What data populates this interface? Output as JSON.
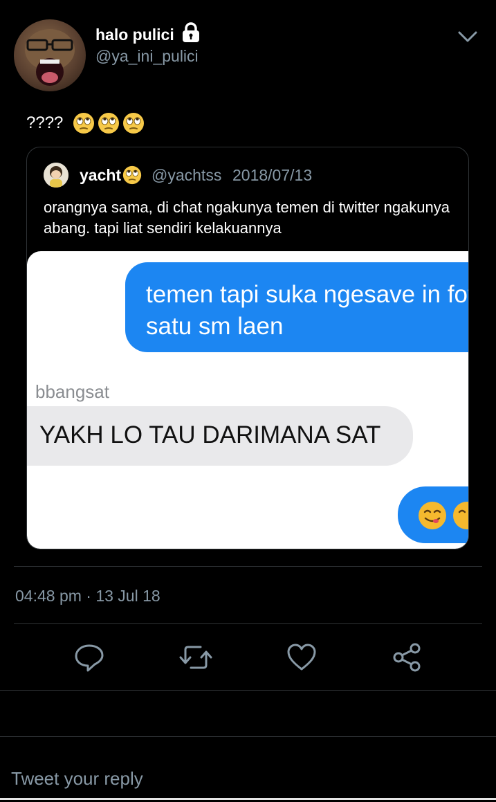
{
  "author": {
    "display_name": "halo pulici",
    "handle": "@ya_ini_pulici",
    "protected": true
  },
  "tweet": {
    "text": "????",
    "emoji_count": 3,
    "timestamp": "04:48 pm · 13 Jul 18"
  },
  "quoted_tweet": {
    "display_name": "yacht",
    "handle": "@yachtss",
    "date": "2018/07/13",
    "text": "orangnya sama, di chat ngakunya temen di twitter ngakunya abang. tapi liat sendiri kelakuannya",
    "image": {
      "outgoing_message": "temen tapi suka ngesave in foto\nsatu sm laen",
      "sender_name": "bbangsat",
      "incoming_message": "YAKH LO TAU DARIMANA SAT"
    }
  },
  "actions": {
    "reply_icon": "reply-icon",
    "retweet_icon": "retweet-icon",
    "like_icon": "heart-icon",
    "share_icon": "share-icon"
  },
  "reply": {
    "placeholder": "Tweet your reply"
  },
  "colors": {
    "background": "#000000",
    "secondary_text": "#8899a6",
    "divider": "#2f3336",
    "imessage_blue": "#1c86f2",
    "imessage_gray": "#e9e9eb"
  }
}
